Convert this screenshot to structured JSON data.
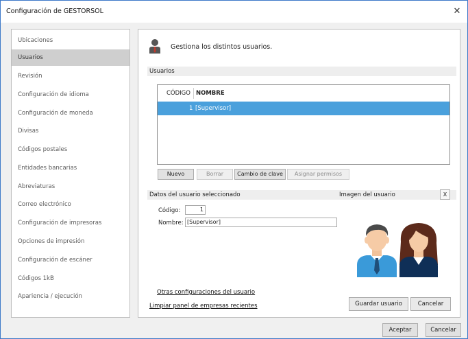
{
  "window": {
    "title": "Configuración de GESTORSOL",
    "close_symbol": "✕"
  },
  "sidebar": {
    "items": [
      {
        "label": "Ubicaciones"
      },
      {
        "label": "Usuarios"
      },
      {
        "label": "Revisión"
      },
      {
        "label": "Configuración de idioma"
      },
      {
        "label": "Configuración de moneda"
      },
      {
        "label": "Divisas"
      },
      {
        "label": "Códigos postales"
      },
      {
        "label": "Entidades bancarias"
      },
      {
        "label": "Abreviaturas"
      },
      {
        "label": "Correo electrónico"
      },
      {
        "label": "Configuración de impresoras"
      },
      {
        "label": "Opciones de impresión"
      },
      {
        "label": "Configuración de escáner"
      },
      {
        "label": "Códigos 1kB"
      },
      {
        "label": "Apariencia / ejecución"
      }
    ],
    "selected": "Usuarios"
  },
  "main": {
    "header_text": "Gestiona los distintos usuarios.",
    "users_section_label": "Usuarios",
    "table": {
      "headers": [
        "CÓDIGO",
        "NOMBRE"
      ],
      "rows": [
        {
          "codigo": "1",
          "nombre": "[Supervisor]"
        }
      ]
    },
    "buttons": {
      "nuevo": "Nuevo",
      "borrar": "Borrar",
      "cambio_clave": "Cambio de clave",
      "asignar_permisos": "Asignar permisos"
    },
    "details_section_label": "Datos del usuario seleccionado",
    "image_section_label": "Imagen del usuario",
    "image_clear": "X",
    "codigo_label": "Código:",
    "codigo_value": "1",
    "nombre_label": "Nombre:",
    "nombre_value": "[Supervisor]",
    "otras_config_link": "Otras configuraciones del usuario",
    "limpiar_link": "Limpiar panel de empresas recientes",
    "guardar_button": "Guardar usuario",
    "cancelar_button": "Cancelar"
  },
  "footer": {
    "aceptar": "Aceptar",
    "cancelar": "Cancelar"
  },
  "colors": {
    "selection": "#4aa0dc",
    "sidebar_selected": "#cfcfcf",
    "window_border": "#3c78c8"
  }
}
